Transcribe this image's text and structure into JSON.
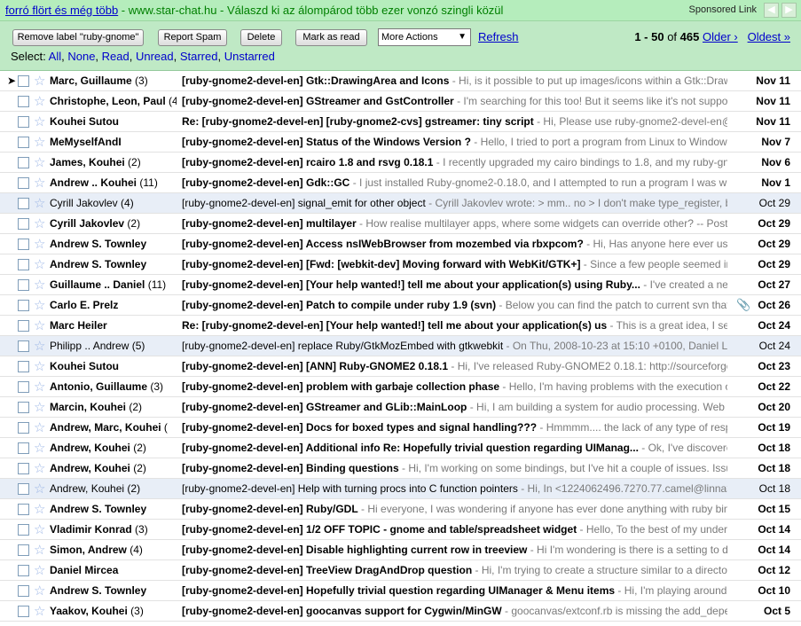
{
  "ad": {
    "link_text": "forró flört és még több",
    "rest_text": " - www.star-chat.hu - Válaszd ki az álompárod több ezer vonzó szingli közül",
    "sponsored": "Sponsored Link",
    "prev_glyph": "◀",
    "next_glyph": "▶"
  },
  "toolbar": {
    "remove_label": "Remove label \"ruby-gnome\"",
    "report_spam": "Report Spam",
    "delete": "Delete",
    "mark_read": "Mark as read",
    "more_actions": "More Actions",
    "refresh": "Refresh",
    "range": "1 - 50",
    "of": "of",
    "total": "465",
    "older": "Older ›",
    "oldest": "Oldest »"
  },
  "select": {
    "label": "Select:",
    "all": "All",
    "none": "None",
    "read": "Read",
    "unread": "Unread",
    "starred": "Starred",
    "unstarred": "Unstarred"
  },
  "icons": {
    "pointer": "arrow-pointer",
    "star": "star-outline",
    "attachment": "paperclip"
  },
  "colors": {
    "ad_bg": "#b5edbc",
    "toolbar_bg": "#bfe9c5",
    "link": "#0000cc",
    "read_row": "#e8eef7"
  },
  "emails": [
    {
      "sender": "Marc, Guillaume",
      "count": "(3)",
      "subject": "[ruby-gnome2-devel-en] Gtk::DrawingArea and Icons",
      "preview": " - Hi, is it possible to put up images/icons within a Gtk::DrawingArea?",
      "date": "Nov 11",
      "unread": true,
      "attach": false,
      "pointer": true
    },
    {
      "sender": "Christophe, Leon, Paul",
      "count": "(4",
      "subject": "[ruby-gnome2-devel-en] GStreamer and GstController",
      "preview": " - I'm searching for this too! But it seems like it's not supported right now",
      "date": "Nov 11",
      "unread": true,
      "attach": false,
      "pointer": false
    },
    {
      "sender": "Kouhei Sutou",
      "count": "",
      "subject": "Re: [ruby-gnome2-devel-en] [ruby-gnome2-cvs] gstreamer: tiny script",
      "preview": " - Hi, Please use ruby-gnome2-devel-en@ not ruby",
      "date": "Nov 11",
      "unread": true,
      "attach": false,
      "pointer": false
    },
    {
      "sender": "MeMyselfAndI",
      "count": "",
      "subject": "[ruby-gnome2-devel-en] Status of the Windows Version ?",
      "preview": " - Hello, I tried to port a program from Linux to Windows. After so",
      "date": "Nov 7",
      "unread": true,
      "attach": false,
      "pointer": false
    },
    {
      "sender": "James, Kouhei",
      "count": "(2)",
      "subject": "[ruby-gnome2-devel-en] rcairo 1.8 and rsvg 0.18.1",
      "preview": " - I recently upgraded my cairo bindings to 1.8, and my ruby-gnome2 bind",
      "date": "Nov 6",
      "unread": true,
      "attach": false,
      "pointer": false
    },
    {
      "sender": "Andrew .. Kouhei",
      "count": "(11)",
      "subject": "[ruby-gnome2-devel-en] Gdk::GC",
      "preview": " - I just installed Ruby-gnome2-0.18.0, and I attempted to run a program I was writing, which",
      "date": "Nov 1",
      "unread": true,
      "attach": false,
      "pointer": false
    },
    {
      "sender": "Cyrill Jakovlev",
      "count": "(4)",
      "subject": "[ruby-gnome2-devel-en] signal_emit for other object",
      "preview": " - Cyrill Jakovlev wrote: > mm.. no > I don't make type_register, because I n",
      "date": "Oct 29",
      "unread": false,
      "attach": false,
      "pointer": false
    },
    {
      "sender": "Cyrill Jakovlev",
      "count": "(2)",
      "subject": "[ruby-gnome2-devel-en] multilayer",
      "preview": " - How realise multilayer apps, where some widgets can override other? -- Posted via http:",
      "date": "Oct 29",
      "unread": true,
      "attach": false,
      "pointer": false
    },
    {
      "sender": "Andrew S. Townley",
      "count": "",
      "subject": "[ruby-gnome2-devel-en] Access nsIWebBrowser from mozembed via rbxpcom?",
      "preview": " - Hi, Has anyone here ever used rbxpcom",
      "date": "Oct 29",
      "unread": true,
      "attach": false,
      "pointer": false
    },
    {
      "sender": "Andrew S. Townley",
      "count": "",
      "subject": "[ruby-gnome2-devel-en] [Fwd: [webkit-dev] Moving forward with WebKit/GTK+]",
      "preview": " - Since a few people seemed interested",
      "date": "Oct 29",
      "unread": true,
      "attach": false,
      "pointer": false
    },
    {
      "sender": "Guillaume .. Daniel",
      "count": "(11)",
      "subject": "[ruby-gnome2-devel-en] [Your help wanted!] tell me about your application(s) using Ruby...",
      "preview": " - I've created a new page o",
      "date": "Oct 27",
      "unread": true,
      "attach": false,
      "pointer": false
    },
    {
      "sender": "Carlo E. Prelz",
      "count": "",
      "subject": "[ruby-gnome2-devel-en] Patch to compile under ruby 1.9 (svn)",
      "preview": " - Below you can find the patch to current svn that needs to be",
      "date": "Oct 26",
      "unread": true,
      "attach": true,
      "pointer": false
    },
    {
      "sender": "Marc Heiler",
      "count": "",
      "subject": "Re: [ruby-gnome2-devel-en] [Your help wanted!] tell me about your application(s) us",
      "preview": " - This is a great idea, I see this as",
      "date": "Oct 24",
      "unread": true,
      "attach": false,
      "pointer": false
    },
    {
      "sender": "Philipp .. Andrew",
      "count": "(5)",
      "subject": "[ruby-gnome2-devel-en] replace Ruby/GtkMozEmbed with gtkwebkit",
      "preview": " - On Thu, 2008-10-23 at 15:10 +0100, Daniel Lucraft wrote",
      "date": "Oct 24",
      "unread": false,
      "attach": false,
      "pointer": false
    },
    {
      "sender": "Kouhei Sutou",
      "count": "",
      "subject": "[ruby-gnome2-devel-en] [ANN] Ruby-GNOME2 0.18.1",
      "preview": " - Hi, I've released Ruby-GNOME2 0.18.1: http://sourceforge.net/proje",
      "date": "Oct 23",
      "unread": true,
      "attach": false,
      "pointer": false
    },
    {
      "sender": "Antonio, Guillaume",
      "count": "(3)",
      "subject": "[ruby-gnome2-devel-en] problem with garbaje collection phase",
      "preview": " - Hello, I'm having problems with the execution of various p",
      "date": "Oct 22",
      "unread": true,
      "attach": false,
      "pointer": false
    },
    {
      "sender": "Marcin, Kouhei",
      "count": "(2)",
      "subject": "[ruby-gnome2-devel-en] GStreamer and GLib::MainLoop",
      "preview": " - Hi, I am building a system for audio processing. Web UI is base",
      "date": "Oct 20",
      "unread": true,
      "attach": false,
      "pointer": false
    },
    {
      "sender": "Andrew, Marc, Kouhei",
      "count": "(",
      "subject": "[ruby-gnome2-devel-en] Docs for boxed types and signal handling???",
      "preview": " - Hmmmm.... the lack of any type of responses to",
      "date": "Oct 19",
      "unread": true,
      "attach": false,
      "pointer": false
    },
    {
      "sender": "Andrew, Kouhei",
      "count": "(2)",
      "subject": "[ruby-gnome2-devel-en] Additional info Re: Hopefully trivial question regarding UIManag...",
      "preview": " - Ok, I've discovered the sig",
      "date": "Oct 18",
      "unread": true,
      "attach": false,
      "pointer": false
    },
    {
      "sender": "Andrew, Kouhei",
      "count": "(2)",
      "subject": "[ruby-gnome2-devel-en] Binding questions",
      "preview": " - Hi, I'm working on some bindings, but I've hit a couple of issues. Issue #1: how",
      "date": "Oct 18",
      "unread": true,
      "attach": false,
      "pointer": false
    },
    {
      "sender": "Andrew, Kouhei",
      "count": "(2)",
      "subject": "[ruby-gnome2-devel-en] Help with turning procs into C function pointers",
      "preview": " - Hi, In <1224062496.7270.77.camel@linna> \"[ruby-gno",
      "date": "Oct 18",
      "unread": false,
      "attach": false,
      "pointer": false
    },
    {
      "sender": "Andrew S. Townley",
      "count": "",
      "subject": "[ruby-gnome2-devel-en] Ruby/GDL",
      "preview": " - Hi everyone, I was wondering if anyone has ever done anything with ruby bindings for G",
      "date": "Oct 15",
      "unread": true,
      "attach": false,
      "pointer": false
    },
    {
      "sender": "Vladimir Konrad",
      "count": "(3)",
      "subject": "[ruby-gnome2-devel-en] 1/2 OFF TOPIC - gnome and table/spreadsheet widget",
      "preview": " - Hello, To the best of my understanding, t",
      "date": "Oct 14",
      "unread": true,
      "attach": false,
      "pointer": false
    },
    {
      "sender": "Simon, Andrew",
      "count": "(4)",
      "subject": "[ruby-gnome2-devel-en] Disable highlighting current row in treeview",
      "preview": " - Hi I'm wondering is there is a setting to disable the a",
      "date": "Oct 14",
      "unread": true,
      "attach": false,
      "pointer": false
    },
    {
      "sender": "Daniel Mircea",
      "count": "",
      "subject": "[ruby-gnome2-devel-en] TreeView DragAndDrop question",
      "preview": " - Hi, I'm trying to create a structure similar to a directory listing, th",
      "date": "Oct 12",
      "unread": true,
      "attach": false,
      "pointer": false
    },
    {
      "sender": "Andrew S. Townley",
      "count": "",
      "subject": "[ruby-gnome2-devel-en] Hopefully trivial question regarding UIManager & Menu items",
      "preview": " - Hi, I'm playing around with the n",
      "date": "Oct 10",
      "unread": true,
      "attach": false,
      "pointer": false
    },
    {
      "sender": "Yaakov, Kouhei",
      "count": "(3)",
      "subject": "[ruby-gnome2-devel-en] goocanvas support for Cygwin/MinGW",
      "preview": " - goocanvas/extconf.rb is missing the add_depend_pack",
      "date": "Oct 5",
      "unread": true,
      "attach": false,
      "pointer": false
    }
  ]
}
